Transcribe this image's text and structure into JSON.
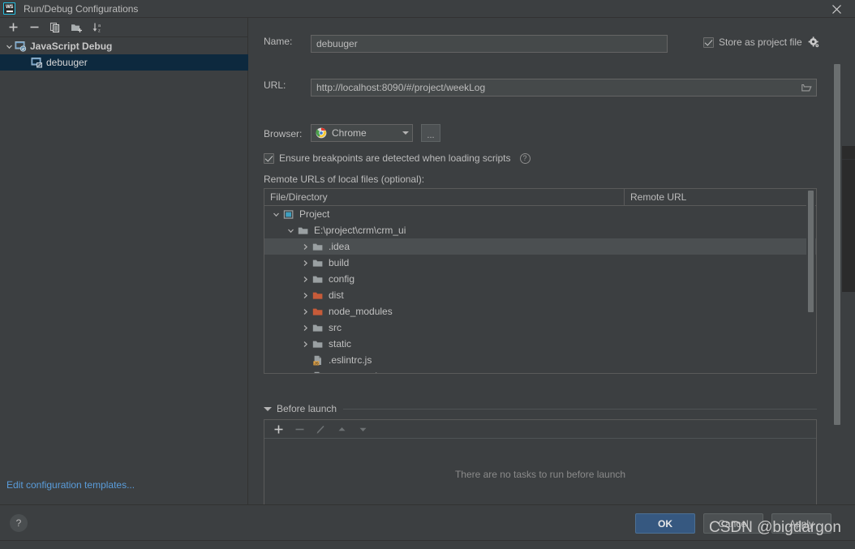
{
  "window": {
    "title": "Run/Debug Configurations",
    "logo_text": "WS",
    "close_icon": "close-icon"
  },
  "sidebar": {
    "toolbar": [
      {
        "name": "add-configuration-button",
        "icon": "plus-icon"
      },
      {
        "name": "remove-configuration-button",
        "icon": "minus-icon"
      },
      {
        "name": "copy-configuration-button",
        "icon": "copy-icon"
      },
      {
        "name": "new-folder-button",
        "icon": "folder-add-icon"
      },
      {
        "name": "sort-configurations-button",
        "icon": "sort-az-icon"
      }
    ],
    "groups": [
      {
        "label": "JavaScript Debug",
        "icon": "js-debug-icon",
        "expanded": true,
        "chevron": "chevron-down-icon",
        "items": [
          {
            "label": "debuuger",
            "icon": "js-debug-config-icon",
            "selected": true
          }
        ]
      }
    ],
    "edit_templates_link": "Edit configuration templates..."
  },
  "form": {
    "name_label": "Name:",
    "name_value": "debuuger",
    "name_placeholder": "",
    "store_as_project_file": {
      "label": "Store as project file",
      "checked": true,
      "gear_icon": "gear-icon"
    },
    "url_label": "URL:",
    "url_value": "http://localhost:8090/#/project/weekLog",
    "url_placeholder": "",
    "url_browse_icon": "folder-open-icon",
    "browser_label": "Browser:",
    "browser_value": "Chrome",
    "browser_icon": "chrome-icon",
    "browser_dropdown_icon": "chevron-down-icon",
    "browser_more_button": "...",
    "ensure_breakpoints": {
      "label": "Ensure breakpoints are detected when loading scripts",
      "checked": true,
      "help_icon": "help-icon"
    },
    "remote_urls_label": "Remote URLs of local files (optional):"
  },
  "file_tree": {
    "columns": [
      "File/Directory",
      "Remote URL"
    ],
    "rows": [
      {
        "label": "Project",
        "icon": "project-icon",
        "chevron": "chevron-down-icon",
        "depth": 0,
        "selected": false
      },
      {
        "label": "E:\\project\\crm\\crm_ui",
        "icon": "folder-icon",
        "chevron": "chevron-down-icon",
        "depth": 1,
        "selected": false
      },
      {
        "label": ".idea",
        "icon": "folder-icon",
        "chevron": "chevron-right-icon",
        "depth": 2,
        "selected": true
      },
      {
        "label": "build",
        "icon": "folder-icon",
        "chevron": "chevron-right-icon",
        "depth": 2,
        "selected": false
      },
      {
        "label": "config",
        "icon": "folder-icon",
        "chevron": "chevron-right-icon",
        "depth": 2,
        "selected": false
      },
      {
        "label": "dist",
        "icon": "folder-excluded-icon",
        "chevron": "chevron-right-icon",
        "depth": 2,
        "selected": false
      },
      {
        "label": "node_modules",
        "icon": "folder-excluded-icon",
        "chevron": "chevron-right-icon",
        "depth": 2,
        "selected": false
      },
      {
        "label": "src",
        "icon": "folder-icon",
        "chevron": "chevron-right-icon",
        "depth": 2,
        "selected": false
      },
      {
        "label": "static",
        "icon": "folder-icon",
        "chevron": "chevron-right-icon",
        "depth": 2,
        "selected": false
      },
      {
        "label": ".eslintrc.js",
        "icon": "js-file-icon",
        "chevron": "",
        "depth": 2,
        "selected": false
      },
      {
        "label": ".postcssrc.js",
        "icon": "js-file-icon",
        "chevron": "",
        "depth": 2,
        "selected": false
      }
    ]
  },
  "before_launch": {
    "title": "Before launch",
    "collapse_icon": "triangle-down-icon",
    "toolbar": [
      {
        "name": "add-task-button",
        "icon": "plus-icon",
        "enabled": true
      },
      {
        "name": "remove-task-button",
        "icon": "minus-icon",
        "enabled": false
      },
      {
        "name": "edit-task-button",
        "icon": "pencil-icon",
        "enabled": false
      },
      {
        "name": "move-up-button",
        "icon": "arrow-up-icon",
        "enabled": false
      },
      {
        "name": "move-down-button",
        "icon": "arrow-down-icon",
        "enabled": false
      }
    ],
    "empty_text": "There are no tasks to run before launch"
  },
  "footer": {
    "help_button": "?",
    "ok_label": "OK",
    "cancel_label": "Cancel",
    "apply_label": "Apply"
  },
  "watermark": "CSDN @bigdargon",
  "colors": {
    "background": "#3c3f41",
    "selection_blue": "#0d293e",
    "primary_button": "#365880",
    "link": "#5a9ddb",
    "folder_excluded": "#c75b39",
    "accent_cyan": "#27c3e6"
  }
}
